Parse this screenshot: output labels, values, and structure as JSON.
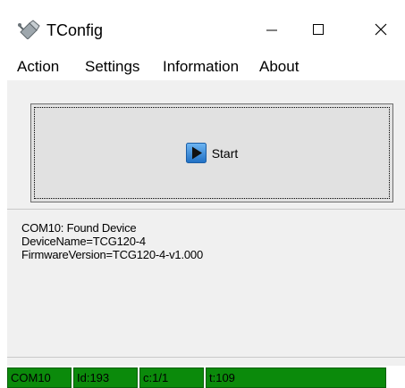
{
  "window": {
    "title": "TConfig",
    "app_icon": "satellite-dish-icon",
    "controls": [
      "minimize-icon",
      "maximize-icon",
      "close-icon"
    ]
  },
  "menu": {
    "items": [
      {
        "label": "Action"
      },
      {
        "label": "Settings"
      },
      {
        "label": "Information"
      },
      {
        "label": "About"
      }
    ]
  },
  "start_button": {
    "label": "Start",
    "icon": "play-icon"
  },
  "log": {
    "lines": [
      "COM10: Found Device",
      "DeviceName=TCG120-4",
      "FirmwareVersion=TCG120-4-v1.000"
    ]
  },
  "status": {
    "cells": [
      {
        "text": "COM10"
      },
      {
        "text": "Id:193"
      },
      {
        "text": "c:1/1"
      },
      {
        "text": "t:109"
      }
    ],
    "color": "#0b8a0b"
  }
}
